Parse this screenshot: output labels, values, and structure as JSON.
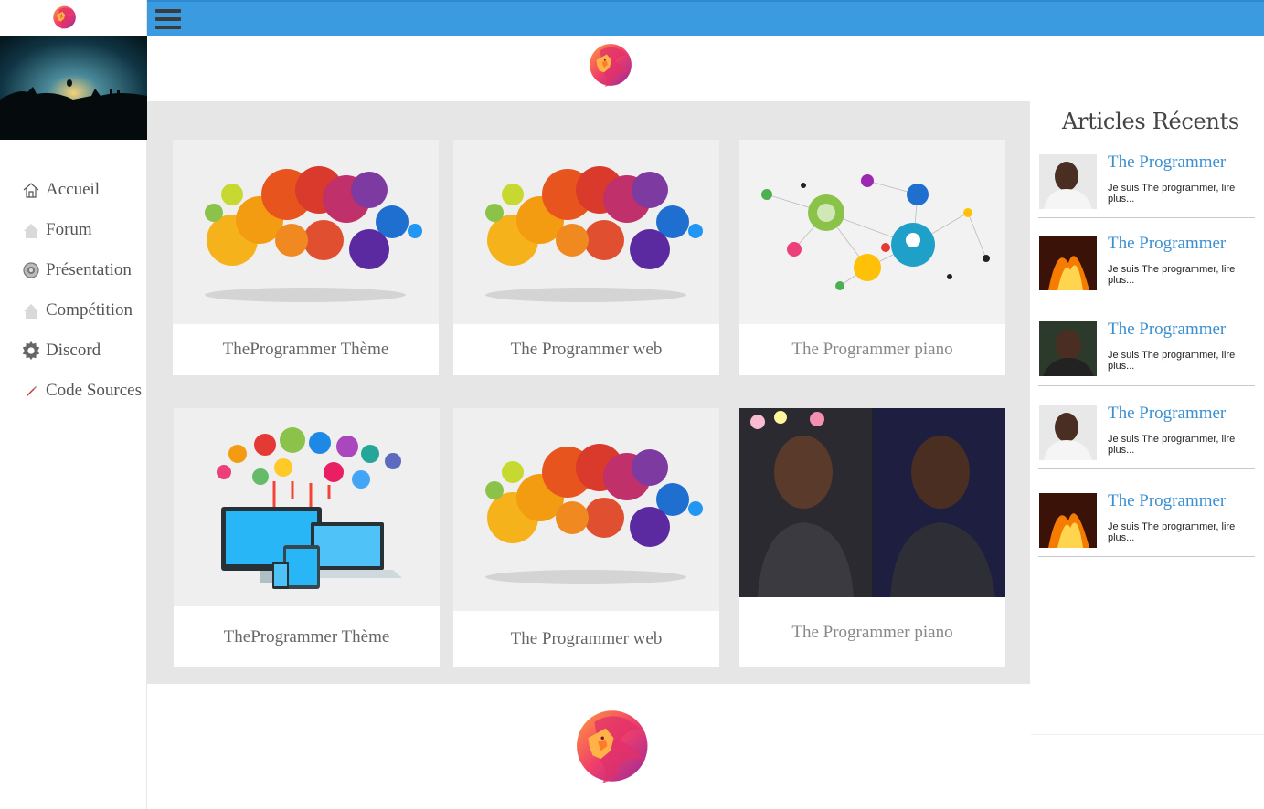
{
  "nav": {
    "items": [
      {
        "label": "Accueil",
        "icon": "home-icon"
      },
      {
        "label": "Forum",
        "icon": "house-icon"
      },
      {
        "label": "Présentation",
        "icon": "settings-wheel-icon"
      },
      {
        "label": "Compétition",
        "icon": "house-icon"
      },
      {
        "label": "Discord",
        "icon": "gear-icon"
      },
      {
        "label": "Code Sources",
        "icon": "pencil-icon"
      }
    ]
  },
  "cards": [
    {
      "caption": "TheProgrammer Thème",
      "image": "colorful-social-clouds"
    },
    {
      "caption": "The Programmer web",
      "image": "colorful-social-clouds"
    },
    {
      "caption": "The Programmer piano",
      "image": "network-icons"
    },
    {
      "caption": "TheProgrammer Thème",
      "image": "devices-cloud"
    },
    {
      "caption": "The Programmer web",
      "image": "colorful-social-clouds"
    },
    {
      "caption": "The Programmer piano",
      "image": "photo-grid-portraits"
    }
  ],
  "recent": {
    "title": "Articles Récents",
    "items": [
      {
        "title": "The Programmer",
        "excerpt": "Je suis The programmer, lire plus..."
      },
      {
        "title": "The Programmer",
        "excerpt": "Je suis The programmer, lire plus..."
      },
      {
        "title": "The Programmer",
        "excerpt": "Je suis The programmer, lire plus..."
      },
      {
        "title": "The Programmer",
        "excerpt": "Je suis The programmer, lire plus..."
      },
      {
        "title": "The Programmer",
        "excerpt": "Je suis The programmer, lire plus..."
      }
    ]
  },
  "colors": {
    "topbar": "#3a9be0",
    "accent_link": "#3a8fd0",
    "panel": "#e6e6e6"
  }
}
